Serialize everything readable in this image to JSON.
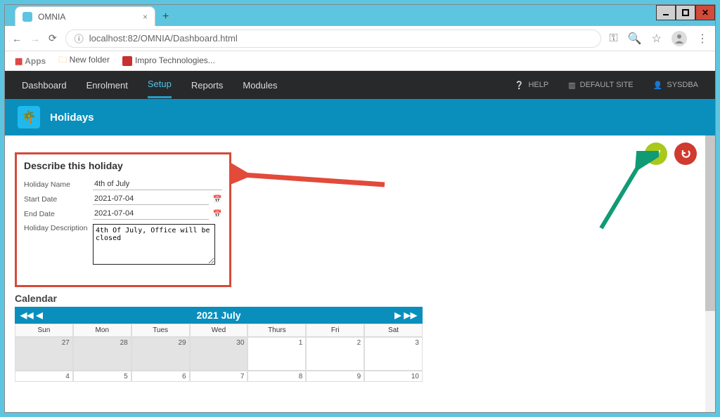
{
  "browser": {
    "tab_title": "OMNIA",
    "url_prefix_icon": "ⓘ",
    "url": "localhost:82/OMNIA/Dashboard.html",
    "bookmarks": {
      "apps": "Apps",
      "new_folder": "New folder",
      "impro": "Impro Technologies..."
    }
  },
  "nav": {
    "items": [
      "Dashboard",
      "Enrolment",
      "Setup",
      "Reports",
      "Modules"
    ],
    "help": "HELP",
    "site": "DEFAULT SITE",
    "user": "SYSDBA"
  },
  "page": {
    "title": "Holidays"
  },
  "form": {
    "heading": "Describe this holiday",
    "name_label": "Holiday Name",
    "name_value": "4th of July",
    "start_label": "Start Date",
    "start_value": "2021-07-04",
    "end_label": "End Date",
    "end_value": "2021-07-04",
    "desc_label": "Holiday Description",
    "desc_value": "4th Of July, Office will be closed"
  },
  "calendar": {
    "heading": "Calendar",
    "title": "2021 July",
    "days": [
      "Sun",
      "Mon",
      "Tues",
      "Wed",
      "Thurs",
      "Fri",
      "Sat"
    ],
    "row1": [
      "27",
      "28",
      "29",
      "30",
      "1",
      "2",
      "3"
    ],
    "row1_dim": [
      true,
      true,
      true,
      true,
      false,
      false,
      false
    ],
    "row2": [
      "4",
      "5",
      "6",
      "7",
      "8",
      "9",
      "10"
    ]
  }
}
